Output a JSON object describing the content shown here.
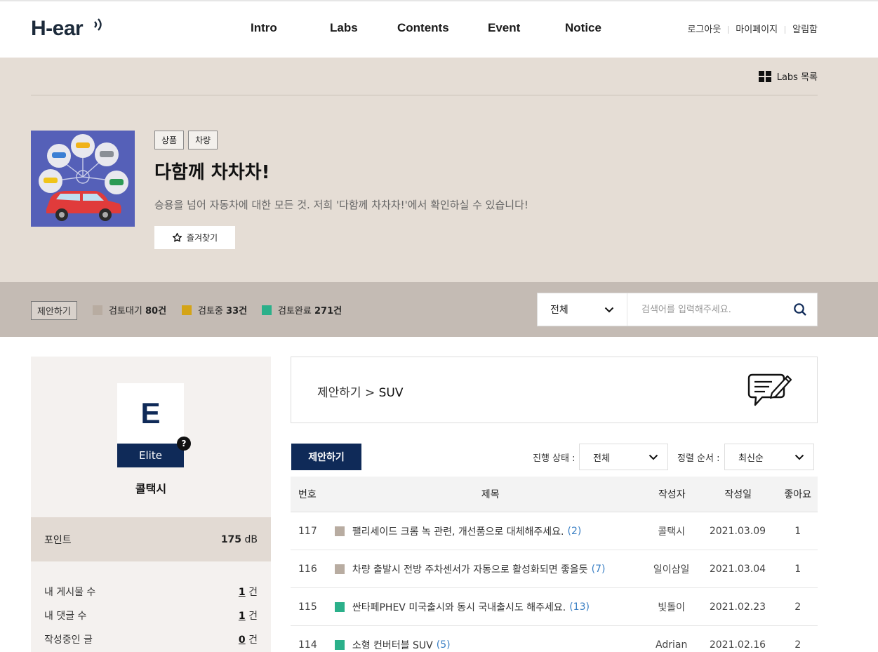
{
  "header": {
    "logo": "H-ear",
    "nav": [
      "Intro",
      "Labs",
      "Contents",
      "Event",
      "Notice"
    ],
    "util": [
      "로그아웃",
      "마이페이지",
      "알림함"
    ]
  },
  "hero": {
    "labs_list": "Labs 목록",
    "tags": [
      "상품",
      "차량"
    ],
    "title": "다함께 차차차!",
    "description": "승용을 넘어 자동차에 대한 모든 것. 저희 '다함께 차차차!'에서 확인하실 수 있습니다!",
    "favorite": "즐겨찾기"
  },
  "statusbar": {
    "label": "제안하기",
    "stats": [
      {
        "label": "검토대기",
        "count": "80건",
        "color": "#b8aca1"
      },
      {
        "label": "검토중",
        "count": "33건",
        "color": "#d4a417"
      },
      {
        "label": "검토완료",
        "count": "271건",
        "color": "#2bb08a"
      }
    ],
    "search": {
      "scope": "전체",
      "placeholder": "검색어를 입력해주세요."
    }
  },
  "sidebar": {
    "grade_letter": "E",
    "grade": "Elite",
    "help": "?",
    "nickname": "콜택시",
    "point_label": "포인트",
    "point_value": "175",
    "point_unit": "dB",
    "stats": [
      {
        "label": "내 게시물 수",
        "value": "1",
        "unit": "건"
      },
      {
        "label": "내 댓글 수",
        "value": "1",
        "unit": "건"
      },
      {
        "label": "작성중인 글",
        "value": "0",
        "unit": "건"
      }
    ]
  },
  "main": {
    "breadcrumb_parent": "제안하기",
    "breadcrumb_sep": ">",
    "breadcrumb_current": "SUV",
    "write_button": "제안하기",
    "filter_status_label": "진행 상태 :",
    "filter_status_value": "전체",
    "sort_label": "정렬 순서 :",
    "sort_value": "최신순",
    "columns": [
      "번호",
      "제목",
      "작성자",
      "작성일",
      "좋아요"
    ],
    "rows": [
      {
        "no": "117",
        "status_color": "#b8aca1",
        "title": "팰리세이드 크롬 녹 관련, 개선품으로 대체해주세요.",
        "comments": "(2)",
        "author": "콜택시",
        "date": "2021.03.09",
        "likes": "1"
      },
      {
        "no": "116",
        "status_color": "#b8aca1",
        "title": "차량 출발시 전방 주차센서가 자동으로 활성화되면 좋을듯",
        "comments": "(7)",
        "author": "일이삼일",
        "date": "2021.03.04",
        "likes": "1"
      },
      {
        "no": "115",
        "status_color": "#2bb08a",
        "title": "싼타페PHEV 미국출시와 동시 국내출시도 해주세요.",
        "comments": "(13)",
        "author": "빛돌이",
        "date": "2021.02.23",
        "likes": "2"
      },
      {
        "no": "114",
        "status_color": "#2bb08a",
        "title": "소형 컨버터블 SUV",
        "comments": "(5)",
        "author": "Adrian",
        "date": "2021.02.16",
        "likes": "2"
      }
    ]
  }
}
